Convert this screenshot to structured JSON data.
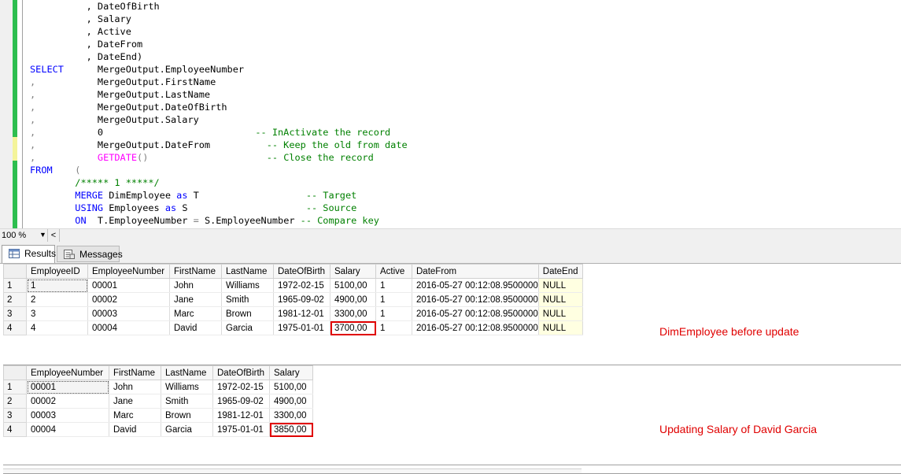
{
  "editor": {
    "lines": [
      {
        "segs": [
          {
            "t": "          , DateOfBirth",
            "c": ""
          }
        ]
      },
      {
        "segs": [
          {
            "t": "          , Salary",
            "c": ""
          }
        ]
      },
      {
        "segs": [
          {
            "t": "          , Active",
            "c": ""
          }
        ]
      },
      {
        "segs": [
          {
            "t": "          , DateFrom",
            "c": ""
          }
        ]
      },
      {
        "segs": [
          {
            "t": "          , DateEnd)",
            "c": ""
          }
        ]
      },
      {
        "segs": [
          {
            "t": "SELECT",
            "c": "kw"
          },
          {
            "t": "      MergeOutput.EmployeeNumber",
            "c": ""
          }
        ]
      },
      {
        "segs": [
          {
            "t": ",",
            "c": "gr"
          },
          {
            "t": "           MergeOutput.FirstName",
            "c": ""
          }
        ]
      },
      {
        "segs": [
          {
            "t": ",",
            "c": "gr"
          },
          {
            "t": "           MergeOutput.LastName",
            "c": ""
          }
        ]
      },
      {
        "segs": [
          {
            "t": ",",
            "c": "gr"
          },
          {
            "t": "           MergeOutput.DateOfBirth",
            "c": ""
          }
        ]
      },
      {
        "segs": [
          {
            "t": ",",
            "c": "gr"
          },
          {
            "t": "           MergeOutput.Salary",
            "c": ""
          }
        ]
      },
      {
        "segs": [
          {
            "t": ",",
            "c": "gr"
          },
          {
            "t": "           0                           ",
            "c": ""
          },
          {
            "t": "-- InActivate the record",
            "c": "cm"
          }
        ]
      },
      {
        "segs": [
          {
            "t": ",",
            "c": "gr"
          },
          {
            "t": "           MergeOutput.DateFrom          ",
            "c": ""
          },
          {
            "t": "-- Keep the old from date",
            "c": "cm"
          }
        ]
      },
      {
        "segs": [
          {
            "t": ",",
            "c": "gr"
          },
          {
            "t": "           ",
            "c": ""
          },
          {
            "t": "GETDATE",
            "c": "fn"
          },
          {
            "t": "()",
            "c": "gr"
          },
          {
            "t": "                     ",
            "c": ""
          },
          {
            "t": "-- Close the record",
            "c": "cm"
          }
        ]
      },
      {
        "segs": [
          {
            "t": "FROM",
            "c": "kw"
          },
          {
            "t": "    ",
            "c": ""
          },
          {
            "t": "(",
            "c": "gr"
          }
        ]
      },
      {
        "segs": [
          {
            "t": "        ",
            "c": ""
          },
          {
            "t": "/***** 1 *****/",
            "c": "cm"
          }
        ]
      },
      {
        "segs": [
          {
            "t": "        ",
            "c": ""
          },
          {
            "t": "MERGE",
            "c": "kw"
          },
          {
            "t": " DimEmployee ",
            "c": ""
          },
          {
            "t": "as",
            "c": "kw"
          },
          {
            "t": " T                   ",
            "c": ""
          },
          {
            "t": "-- Target",
            "c": "cm"
          }
        ]
      },
      {
        "segs": [
          {
            "t": "        ",
            "c": ""
          },
          {
            "t": "USING",
            "c": "kw"
          },
          {
            "t": " Employees ",
            "c": ""
          },
          {
            "t": "as",
            "c": "kw"
          },
          {
            "t": " S                     ",
            "c": ""
          },
          {
            "t": "-- Source",
            "c": "cm"
          }
        ]
      },
      {
        "segs": [
          {
            "t": "        ",
            "c": ""
          },
          {
            "t": "ON",
            "c": "kw"
          },
          {
            "t": "  T.EmployeeNumber ",
            "c": ""
          },
          {
            "t": "=",
            "c": "gr"
          },
          {
            "t": " S.EmployeeNumber ",
            "c": ""
          },
          {
            "t": "-- Compare key",
            "c": "cm"
          }
        ]
      }
    ]
  },
  "statusbar": {
    "zoom": "100 %"
  },
  "tabs": {
    "results": "Results",
    "messages": "Messages"
  },
  "grid1": {
    "columns": [
      "EmployeeID",
      "EmployeeNumber",
      "FirstName",
      "LastName",
      "DateOfBirth",
      "Salary",
      "Active",
      "DateFrom",
      "DateEnd"
    ],
    "rows": [
      [
        "1",
        "1",
        "00001",
        "John",
        "Williams",
        "1972-02-15",
        "5100,00",
        "1",
        "2016-05-27 00:12:08.9500000",
        "NULL"
      ],
      [
        "2",
        "2",
        "00002",
        "Jane",
        "Smith",
        "1965-09-02",
        "4900,00",
        "1",
        "2016-05-27 00:12:08.9500000",
        "NULL"
      ],
      [
        "3",
        "3",
        "00003",
        "Marc",
        "Brown",
        "1981-12-01",
        "3300,00",
        "1",
        "2016-05-27 00:12:08.9500000",
        "NULL"
      ],
      [
        "4",
        "4",
        "00004",
        "David",
        "Garcia",
        "1975-01-01",
        "3700,00",
        "1",
        "2016-05-27 00:12:08.9500000",
        "NULL"
      ]
    ],
    "annotation": "DimEmployee before update"
  },
  "grid2": {
    "columns": [
      "EmployeeNumber",
      "FirstName",
      "LastName",
      "DateOfBirth",
      "Salary"
    ],
    "rows": [
      [
        "1",
        "00001",
        "John",
        "Williams",
        "1972-02-15",
        "5100,00"
      ],
      [
        "2",
        "00002",
        "Jane",
        "Smith",
        "1965-09-02",
        "4900,00"
      ],
      [
        "3",
        "00003",
        "Marc",
        "Brown",
        "1981-12-01",
        "3300,00"
      ],
      [
        "4",
        "00004",
        "David",
        "Garcia",
        "1975-01-01",
        "3850,00"
      ]
    ],
    "annotation": "Updating Salary of David Garcia"
  },
  "colors": {
    "keyword": "#0000ff",
    "comment": "#008000",
    "function": "#ff00ff",
    "annotation": "#e00000",
    "changebar_saved": "#2dbe4f",
    "changebar_unsaved": "#f4f49a"
  }
}
